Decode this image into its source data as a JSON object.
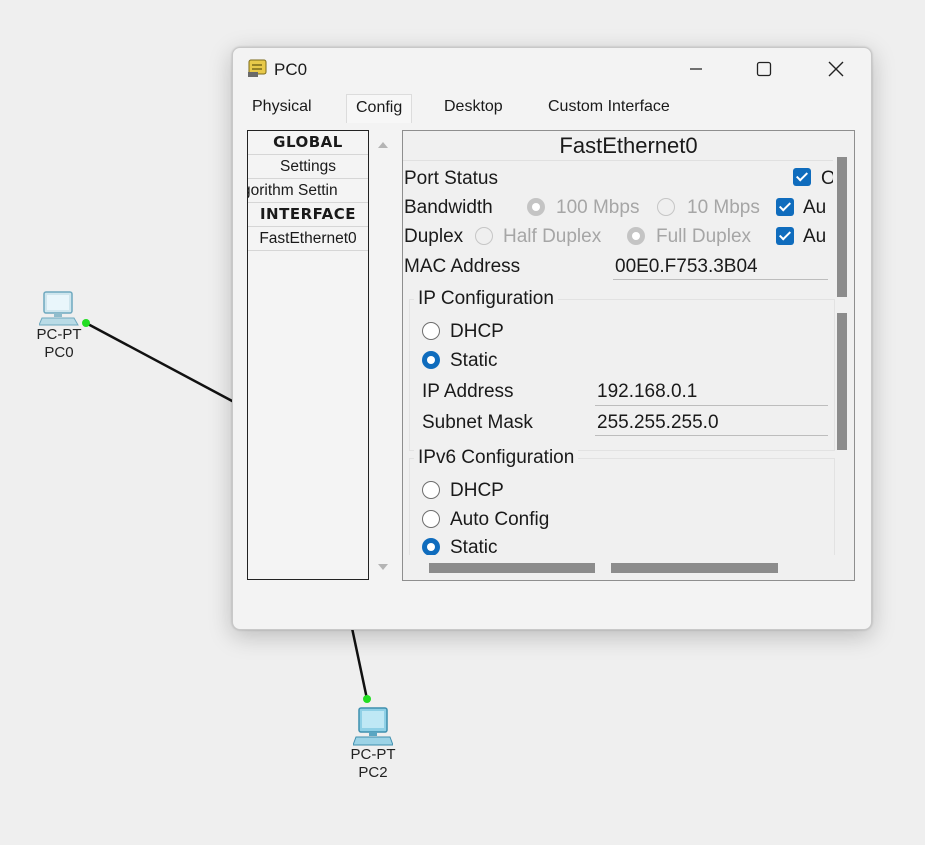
{
  "workspace": {
    "devices": [
      {
        "type": "PC-PT",
        "name": "PC0"
      },
      {
        "type": "PC-PT",
        "name": "PC2"
      }
    ]
  },
  "window": {
    "title": "PC0",
    "tabs": [
      {
        "label": "Physical",
        "active": false
      },
      {
        "label": "Config",
        "active": true
      },
      {
        "label": "Desktop",
        "active": false
      },
      {
        "label": "Custom Interface",
        "active": false
      }
    ]
  },
  "left_list": {
    "items": [
      {
        "label": "GLOBAL",
        "kind": "header"
      },
      {
        "label": "Settings",
        "kind": "item"
      },
      {
        "label": "gorithm Settin",
        "kind": "item"
      },
      {
        "label": "INTERFACE",
        "kind": "header"
      },
      {
        "label": "FastEthernet0",
        "kind": "item"
      }
    ]
  },
  "interface_panel": {
    "title": "FastEthernet0",
    "port_status_label": "Port Status",
    "port_status_on_label": "O",
    "port_status_checked": true,
    "bandwidth_label": "Bandwidth",
    "bandwidth_options": [
      "100 Mbps",
      "10 Mbps"
    ],
    "bandwidth_auto_label": "Au",
    "bandwidth_auto_checked": true,
    "duplex_label": "Duplex",
    "duplex_options": [
      "Half Duplex",
      "Full Duplex"
    ],
    "duplex_auto_label": "Au",
    "duplex_auto_checked": true,
    "mac_label": "MAC Address",
    "mac_value": "00E0.F753.3B04",
    "ip_config": {
      "title": "IP Configuration",
      "dhcp_label": "DHCP",
      "static_label": "Static",
      "selected": "Static",
      "ip_label": "IP Address",
      "ip_value": "192.168.0.1",
      "mask_label": "Subnet Mask",
      "mask_value": "255.255.255.0"
    },
    "ipv6_config": {
      "title": "IPv6 Configuration",
      "dhcp_label": "DHCP",
      "auto_label": "Auto Config",
      "static_label": "Static",
      "selected": "Static"
    }
  },
  "colors": {
    "accent": "#0f6cbd",
    "link_dot": "#22dd22",
    "background": "#efefef"
  }
}
